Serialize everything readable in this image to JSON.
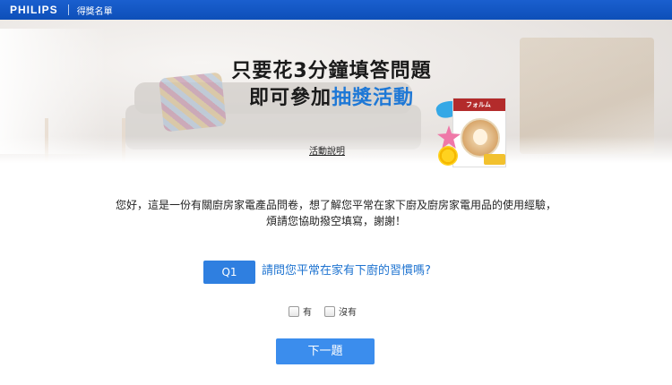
{
  "header": {
    "brand": "PHILIPS",
    "winners_link": "得獎名單"
  },
  "hero": {
    "title_line1": "只要花3分鐘填答問題",
    "title_line2_prefix": "即可參加",
    "title_line2_highlight": "抽獎活動",
    "activity_link": "活動說明",
    "product_label": "フォルム"
  },
  "intro": {
    "line1": "您好，這是一份有關廚房家電產品問卷，想了解您平常在家下廚及廚房家電用品的使用經驗，",
    "line2": "煩請您協助撥空填寫，謝謝！"
  },
  "question": {
    "number": "Q1",
    "text": "請問您平常在家有下廚的習慣嗎?",
    "options": [
      {
        "label": "有",
        "checked": false
      },
      {
        "label": "沒有",
        "checked": false
      }
    ]
  },
  "actions": {
    "next_label": "下一題"
  },
  "colors": {
    "topbar": "#0d4fb8",
    "accent": "#2f7fe0",
    "highlight_text": "#1e78d6"
  }
}
